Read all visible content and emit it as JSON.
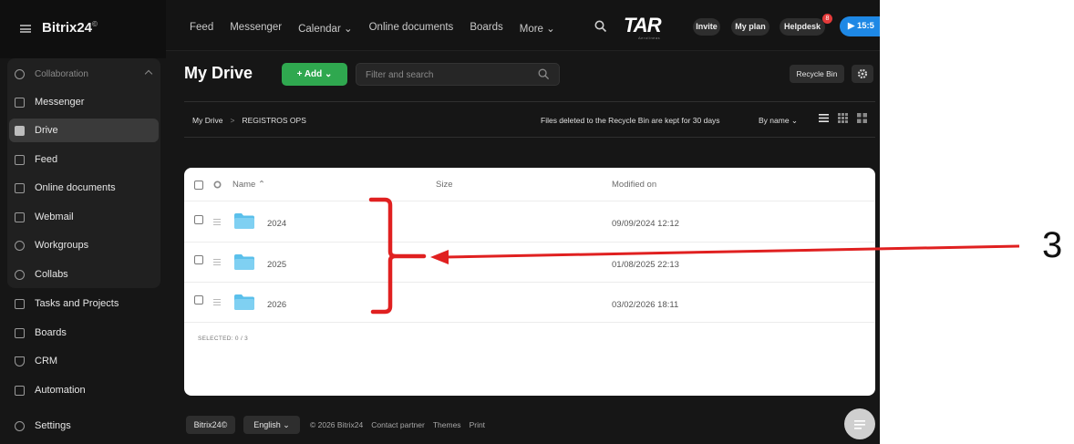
{
  "app": {
    "brand": "Bitrix24",
    "brand_mark": "©"
  },
  "topnav": {
    "items": [
      "Feed",
      "Messenger",
      "Calendar ⌄",
      "Online documents",
      "Boards",
      "More ⌄"
    ],
    "logo": "TAR",
    "logo_sub": "Aerolíneas",
    "invite": "Invite",
    "my_plan": "My plan",
    "helpdesk": "Helpdesk",
    "notification_count": "8",
    "time": "▶ 15:5"
  },
  "sidebar": {
    "group_label": "Collaboration",
    "items": [
      {
        "label": "Messenger",
        "icon": "chat-icon"
      },
      {
        "label": "Drive",
        "icon": "drive-icon"
      },
      {
        "label": "Feed",
        "icon": "feed-icon"
      },
      {
        "label": "Online documents",
        "icon": "document-icon"
      },
      {
        "label": "Webmail",
        "icon": "mail-icon"
      },
      {
        "label": "Workgroups",
        "icon": "group-icon"
      },
      {
        "label": "Collabs",
        "icon": "collab-icon"
      },
      {
        "label": "Tasks and Projects",
        "icon": "task-icon"
      },
      {
        "label": "Boards",
        "icon": "board-icon"
      },
      {
        "label": "CRM",
        "icon": "crm-icon"
      },
      {
        "label": "Automation",
        "icon": "automation-icon"
      },
      {
        "label": "Settings",
        "icon": "settings-icon"
      }
    ]
  },
  "main": {
    "title": "My Drive",
    "add_label": "+ Add ⌄",
    "search_placeholder": "Filter and search",
    "recycle_bin": "Recycle Bin",
    "breadcrumb": [
      "My Drive",
      "REGISTROS OPS"
    ],
    "breadcrumb_sep": ">",
    "note": "Files deleted to the Recycle Bin are kept for 30 days",
    "sort_label": "By name ⌄"
  },
  "table": {
    "columns": {
      "name": "Name ⌃",
      "size": "Size",
      "modified": "Modified on"
    },
    "rows": [
      {
        "name": "2024",
        "size": "",
        "modified": "09/09/2024 12:12"
      },
      {
        "name": "2025",
        "size": "",
        "modified": "01/08/2025 22:13"
      },
      {
        "name": "2026",
        "size": "",
        "modified": "03/02/2026 18:11"
      }
    ],
    "selected": "SELECTED: 0 / 3"
  },
  "footer": {
    "brand_btn": "Bitrix24©",
    "language": "English ⌄",
    "copyright": "© 2026 Bitrix24",
    "links": [
      "Contact partner",
      "Themes",
      "Print"
    ]
  },
  "annotation": {
    "number": "3",
    "color": "#e02020"
  },
  "colors": {
    "accent_green": "#2fa84f",
    "accent_blue": "#1e88e5",
    "folder_blue": "#5bc0eb",
    "background_dark": "#161616"
  }
}
